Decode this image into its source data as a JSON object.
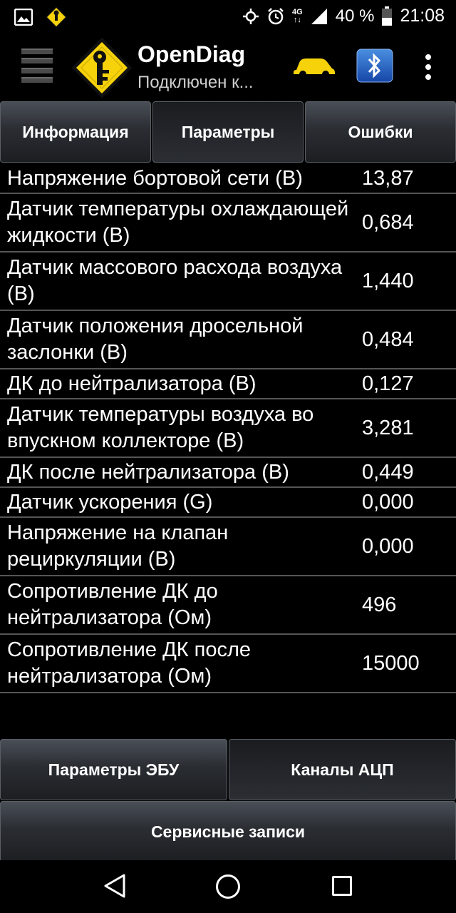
{
  "status_bar": {
    "net_top": "4G",
    "net_bottom": "↑↓",
    "battery": "40 %",
    "time": "21:08",
    "icons": [
      "image-icon",
      "app-notification-icon",
      "gps-icon",
      "alarm-icon",
      "network-icon",
      "signal-icon",
      "battery-icon"
    ]
  },
  "action_bar": {
    "title": "OpenDiag",
    "subtitle": "Подключен к...",
    "accent_color": "#f5d20a"
  },
  "tabs": [
    {
      "label": "Информация",
      "active": false
    },
    {
      "label": "Параметры",
      "active": true
    },
    {
      "label": "Ошибки",
      "active": false
    }
  ],
  "params": [
    {
      "label": "Напряжение бортовой сети (В)",
      "value": "13,87"
    },
    {
      "label": "Датчик температуры охлаждающей жидкости (В)",
      "value": "0,684"
    },
    {
      "label": "Датчик массового расхода воздуха (В)",
      "value": "1,440"
    },
    {
      "label": "Датчик положения дросельной заслонки (В)",
      "value": "0,484"
    },
    {
      "label": "ДК до нейтрализатора (В)",
      "value": "0,127"
    },
    {
      "label": "Датчик температуры воздуха во впускном коллекторе (В)",
      "value": "3,281"
    },
    {
      "label": "ДК после нейтрализатора (В)",
      "value": "0,449"
    },
    {
      "label": "Датчик ускорения (G)",
      "value": "0,000"
    },
    {
      "label": "Напряжение на клапан рециркуляции (В)",
      "value": "0,000"
    },
    {
      "label": "Сопротивление ДК до нейтрализатора (Ом)",
      "value": "496"
    },
    {
      "label": "Сопротивление ДК после нейтрализатора (Ом)",
      "value": "15000"
    }
  ],
  "bottom": {
    "ecu_params": "Параметры ЭБУ",
    "adc_channels": "Каналы АЦП",
    "service_records": "Сервисные записи"
  }
}
